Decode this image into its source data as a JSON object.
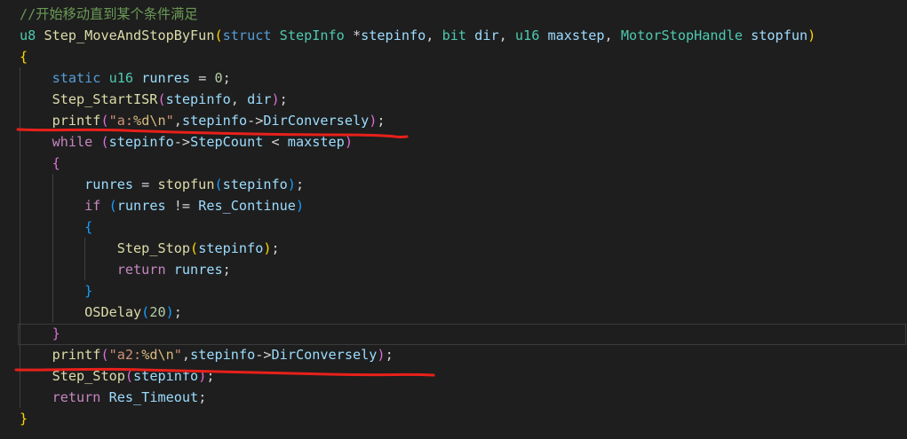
{
  "editor": {
    "lines": [
      {
        "indent": 0,
        "tokens": [
          [
            "com",
            "//开始移动直到某个条件满足"
          ]
        ]
      },
      {
        "indent": 0,
        "tokens": [
          [
            "type",
            "u8"
          ],
          [
            "op",
            " "
          ],
          [
            "fn",
            "Step_MoveAndStopByFun"
          ],
          [
            "brace",
            "("
          ],
          [
            "kw",
            "struct"
          ],
          [
            "op",
            " "
          ],
          [
            "type",
            "StepInfo"
          ],
          [
            "op",
            " *"
          ],
          [
            "var",
            "stepinfo"
          ],
          [
            "op",
            ", "
          ],
          [
            "type",
            "bit"
          ],
          [
            "op",
            " "
          ],
          [
            "var",
            "dir"
          ],
          [
            "op",
            ", "
          ],
          [
            "type",
            "u16"
          ],
          [
            "op",
            " "
          ],
          [
            "var",
            "maxstep"
          ],
          [
            "op",
            ", "
          ],
          [
            "type",
            "MotorStopHandle"
          ],
          [
            "op",
            " "
          ],
          [
            "var",
            "stopfun"
          ],
          [
            "brace",
            ")"
          ]
        ]
      },
      {
        "indent": 0,
        "tokens": [
          [
            "brace",
            "{"
          ]
        ]
      },
      {
        "indent": 1,
        "tokens": [
          [
            "kw",
            "static"
          ],
          [
            "op",
            " "
          ],
          [
            "type",
            "u16"
          ],
          [
            "op",
            " "
          ],
          [
            "var",
            "runres"
          ],
          [
            "op",
            " = "
          ],
          [
            "num",
            "0"
          ],
          [
            "op",
            ";"
          ]
        ]
      },
      {
        "indent": 1,
        "tokens": [
          [
            "fn",
            "Step_StartISR"
          ],
          [
            "paren",
            "("
          ],
          [
            "var",
            "stepinfo"
          ],
          [
            "op",
            ", "
          ],
          [
            "var",
            "dir"
          ],
          [
            "paren",
            ")"
          ],
          [
            "op",
            ";"
          ]
        ]
      },
      {
        "indent": 1,
        "tokens": [
          [
            "fn",
            "printf"
          ],
          [
            "paren",
            "("
          ],
          [
            "str",
            "\"a:"
          ],
          [
            "esc",
            "%d\\n"
          ],
          [
            "str",
            "\""
          ],
          [
            "op",
            ","
          ],
          [
            "var",
            "stepinfo"
          ],
          [
            "op",
            "->"
          ],
          [
            "var",
            "DirConversely"
          ],
          [
            "paren",
            ")"
          ],
          [
            "op",
            ";"
          ]
        ]
      },
      {
        "indent": 1,
        "tokens": [
          [
            "ctl",
            "while"
          ],
          [
            "op",
            " "
          ],
          [
            "paren",
            "("
          ],
          [
            "var",
            "stepinfo"
          ],
          [
            "op",
            "->"
          ],
          [
            "var",
            "StepCount"
          ],
          [
            "op",
            " < "
          ],
          [
            "var",
            "maxstep"
          ],
          [
            "paren",
            ")"
          ]
        ]
      },
      {
        "indent": 1,
        "tokens": [
          [
            "paren",
            "{"
          ]
        ]
      },
      {
        "indent": 2,
        "tokens": [
          [
            "var",
            "runres"
          ],
          [
            "op",
            " = "
          ],
          [
            "fn",
            "stopfun"
          ],
          [
            "paren2",
            "("
          ],
          [
            "var",
            "stepinfo"
          ],
          [
            "paren2",
            ")"
          ],
          [
            "op",
            ";"
          ]
        ]
      },
      {
        "indent": 2,
        "tokens": [
          [
            "ctl",
            "if"
          ],
          [
            "op",
            " "
          ],
          [
            "paren2",
            "("
          ],
          [
            "var",
            "runres"
          ],
          [
            "op",
            " != "
          ],
          [
            "var",
            "Res_Continue"
          ],
          [
            "paren2",
            ")"
          ]
        ]
      },
      {
        "indent": 2,
        "tokens": [
          [
            "paren2",
            "{"
          ]
        ]
      },
      {
        "indent": 3,
        "tokens": [
          [
            "fn",
            "Step_Stop"
          ],
          [
            "brace",
            "("
          ],
          [
            "var",
            "stepinfo"
          ],
          [
            "brace",
            ")"
          ],
          [
            "op",
            ";"
          ]
        ]
      },
      {
        "indent": 3,
        "tokens": [
          [
            "ctl",
            "return"
          ],
          [
            "op",
            " "
          ],
          [
            "var",
            "runres"
          ],
          [
            "op",
            ";"
          ]
        ]
      },
      {
        "indent": 2,
        "tokens": [
          [
            "paren2",
            "}"
          ]
        ]
      },
      {
        "indent": 2,
        "tokens": [
          [
            "fn",
            "OSDelay"
          ],
          [
            "paren2",
            "("
          ],
          [
            "num",
            "20"
          ],
          [
            "paren2",
            ")"
          ],
          [
            "op",
            ";"
          ]
        ]
      },
      {
        "indent": 1,
        "tokens": [
          [
            "paren",
            "}"
          ]
        ]
      },
      {
        "indent": 1,
        "tokens": [
          [
            "fn",
            "printf"
          ],
          [
            "paren",
            "("
          ],
          [
            "str",
            "\"a2:"
          ],
          [
            "esc",
            "%d\\n"
          ],
          [
            "str",
            "\""
          ],
          [
            "op",
            ","
          ],
          [
            "var",
            "stepinfo"
          ],
          [
            "op",
            "->"
          ],
          [
            "var",
            "DirConversely"
          ],
          [
            "paren",
            ")"
          ],
          [
            "op",
            ";"
          ]
        ]
      },
      {
        "indent": 1,
        "tokens": [
          [
            "fn",
            "Step_Stop"
          ],
          [
            "paren",
            "("
          ],
          [
            "var",
            "stepinfo"
          ],
          [
            "paren",
            ")"
          ],
          [
            "op",
            ";"
          ]
        ]
      },
      {
        "indent": 1,
        "tokens": [
          [
            "ctl",
            "return"
          ],
          [
            "op",
            " "
          ],
          [
            "var",
            "Res_Timeout"
          ],
          [
            "op",
            ";"
          ]
        ]
      },
      {
        "indent": 0,
        "tokens": [
          [
            "brace",
            "}"
          ]
        ]
      }
    ]
  },
  "annotations": {
    "underline_color": "#e8201a",
    "underlined_lines": [
      6,
      17
    ]
  }
}
